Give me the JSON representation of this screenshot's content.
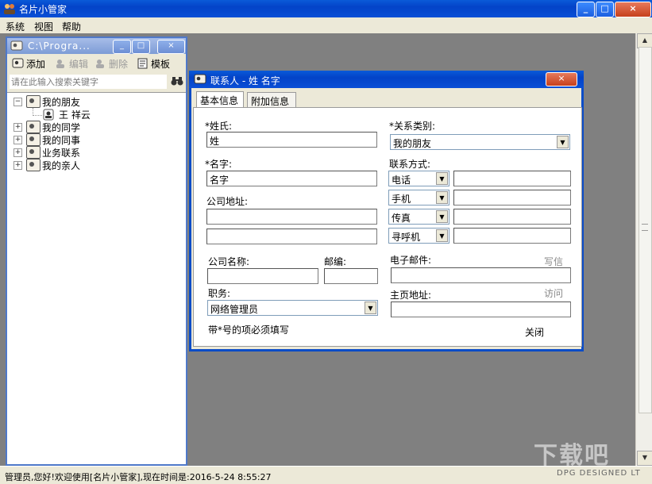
{
  "app": {
    "title": "名片小管家",
    "window_buttons": {
      "minimize": "_",
      "maximize": "□",
      "close": "×"
    }
  },
  "menubar": {
    "items": [
      "系统",
      "视图",
      "帮助"
    ]
  },
  "left_window": {
    "title": "C:\\Progra...",
    "toolbar": {
      "add": "添加",
      "edit": "编辑",
      "delete": "删除",
      "template": "模板"
    },
    "search_placeholder": "请在此输入搜索关键字",
    "tree": [
      {
        "label": "我的朋友",
        "expanded": true,
        "children": [
          "王 祥云"
        ]
      },
      {
        "label": "我的同学",
        "expanded": false
      },
      {
        "label": "我的同事",
        "expanded": false
      },
      {
        "label": "业务联系",
        "expanded": false
      },
      {
        "label": "我的亲人",
        "expanded": false
      }
    ]
  },
  "dialog": {
    "title": "联系人 - 姓 名字",
    "close_label": "×",
    "tabs": [
      "基本信息",
      "附加信息"
    ],
    "fields": {
      "surname_label": "*姓氏:",
      "surname_value": "姓",
      "category_label": "*关系类别:",
      "category_value": "我的朋友",
      "name_label": "*名字:",
      "name_value": "名字",
      "contact_label": "联系方式:",
      "contact_types": [
        "电话",
        "手机",
        "传真",
        "寻呼机"
      ],
      "contact_values": [
        "",
        "",
        "",
        ""
      ],
      "address_label": "公司地址:",
      "address_line1": "",
      "address_line2": "",
      "company_label": "公司名称:",
      "company_value": "",
      "zip_label": "邮编:",
      "zip_value": "",
      "email_label": "电子邮件:",
      "email_action": "写信",
      "email_value": "",
      "position_label": "职务:",
      "position_value": "网络管理员",
      "homepage_label": "主页地址:",
      "homepage_action": "访问",
      "homepage_value": "",
      "required_note": "带*号的项必须填写",
      "close_button": "关闭"
    }
  },
  "statusbar": {
    "text": "管理员,您好!欢迎使用[名片小管家],现在时间是:2016-5-24 8:55:27"
  },
  "watermark": {
    "main": "下载吧",
    "sub": "DPG DESIGNED LT"
  },
  "colors": {
    "titlebar": "#0343c8",
    "mdi_background": "#808080",
    "dialog_bg": "#ece9d8"
  }
}
